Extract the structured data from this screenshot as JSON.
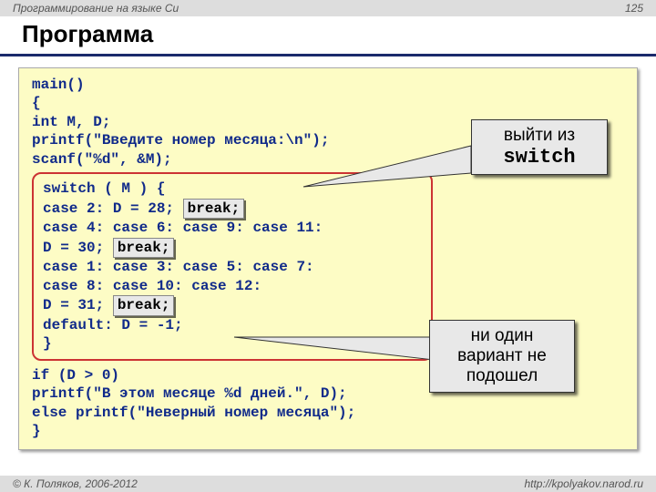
{
  "header": {
    "course": "Программирование на языке Си",
    "page": "125"
  },
  "title": "Программа",
  "code": {
    "l1": "main()",
    "l2": "{",
    "l3": " int M, D;",
    "l4": " printf(\"Введите номер месяца:\\n\");",
    "l5": " scanf(\"%d\", &M);",
    "sw1": "switch ( M ) {",
    "sw2a": "  case 2:  D = 28; ",
    "sw3": "  case 4: case 6: case 9: case 11:",
    "sw4a": "          D = 30; ",
    "sw5": "  case 1: case 3: case 5: case 7:",
    "sw6": "  case 8: case 10: case 12:",
    "sw7a": "          D = 31; ",
    "sw8": "  default: D = -1;",
    "sw9": "  }",
    "break": "break;",
    "l10": " if (D > 0)",
    "l11": "     printf(\"В этом месяце %d дней.\", D);",
    "l12": " else printf(\"Неверный номер месяца\");",
    "l13": "}"
  },
  "callouts": {
    "c1a": "выйти из",
    "c1b": "switch",
    "c2": "ни один вариант не подошел"
  },
  "footer": {
    "copyright": "© К. Поляков, 2006-2012",
    "url": "http://kpolyakov.narod.ru"
  }
}
